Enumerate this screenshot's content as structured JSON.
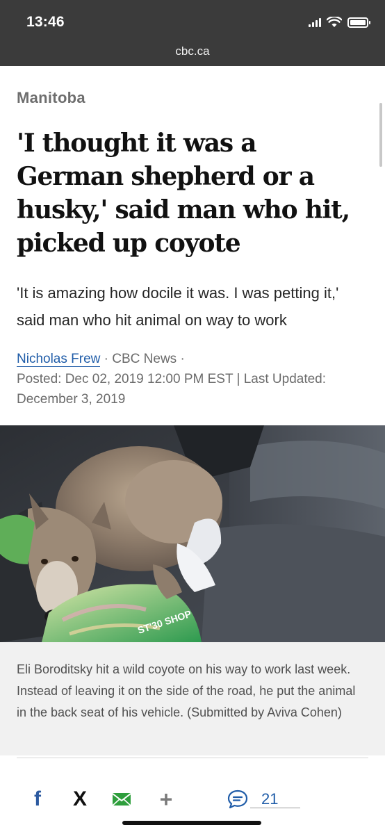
{
  "status": {
    "time": "13:46"
  },
  "browser": {
    "url": "cbc.ca"
  },
  "article": {
    "section": "Manitoba",
    "headline": "'I thought it was a German shepherd or a husky,' said man who hit, picked up coyote",
    "deck": "'It is amazing how docile it was. I was petting it,' said man who hit animal on way to work",
    "author": "Nicholas Frew",
    "outlet": "CBC News",
    "separator": "·",
    "posted": "Posted: Dec 02, 2019 12:00 PM EST | Last Updated: December 3, 2019",
    "caption": "Eli Boroditsky hit a wild coyote on his way to work last week. Instead of leaving it on the side of the road, he put the animal in the back seat of his vehicle. (Submitted by Aviva Cohen)"
  },
  "photo": {
    "bag_text": "ST'30 SHOP"
  },
  "share": {
    "facebook": "f",
    "x": "X",
    "more": "+",
    "comment_count": "21"
  },
  "colors": {
    "chrome": "#3b3b3b",
    "link": "#1f5ca8",
    "facebook": "#2c5aa0",
    "mail": "#2e9e3c"
  }
}
